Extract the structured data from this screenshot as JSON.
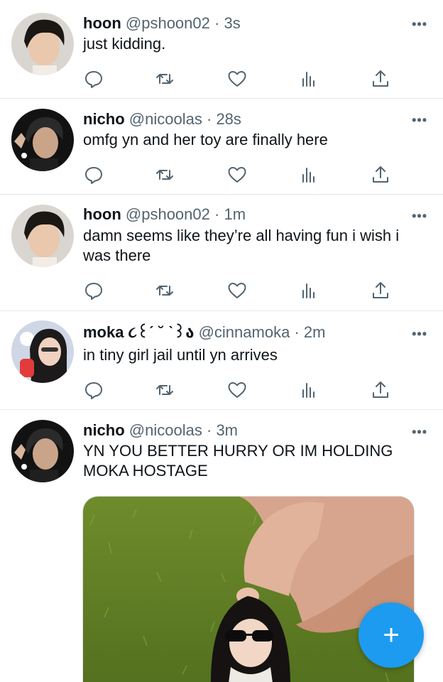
{
  "tweets": [
    {
      "name": "hoon",
      "handle": "@pshoon02",
      "sep": "·",
      "time": "3s",
      "text": "just kidding.",
      "more": "•••"
    },
    {
      "name": "nicho",
      "handle": "@nicoolas",
      "sep": "·",
      "time": "28s",
      "text": "omfg yn and her toy are finally here",
      "more": "•••"
    },
    {
      "name": "hoon",
      "handle": "@pshoon02",
      "sep": "·",
      "time": "1m",
      "text": "damn seems like they’re all having fun i wish i was there",
      "more": "•••"
    },
    {
      "name": "moka ૮꒰ˊ ˘ ˋ꒱ა",
      "handle": "@cinnamoka",
      "sep": "·",
      "time": "2m",
      "text": "in tiny girl jail until yn arrives",
      "more": "•••"
    },
    {
      "name": "nicho",
      "handle": "@nicoolas",
      "sep": "·",
      "time": "3m",
      "text": "YN YOU BETTER HURRY OR IM HOLDING MOKA HOSTAGE",
      "more": "•••"
    }
  ],
  "icons": [
    "reply-icon",
    "retweet-icon",
    "like-icon",
    "views-icon",
    "share-icon"
  ],
  "fab": {
    "label": "+"
  },
  "colors": {
    "accent": "#1d9bf0",
    "icon": "#536471",
    "divider": "#e4e7ea"
  }
}
